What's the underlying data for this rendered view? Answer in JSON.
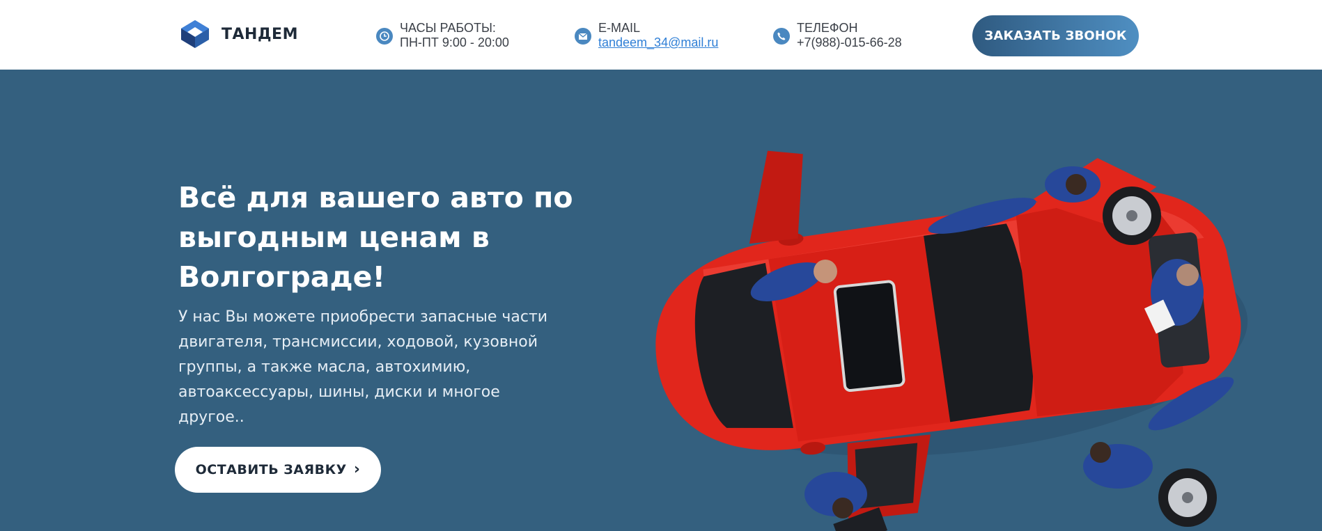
{
  "header": {
    "logo_text": "ТАНДЕМ",
    "hours": {
      "label": "ЧАСЫ РАБОТЫ:",
      "value": "ПН-ПТ 9:00 - 20:00",
      "icon": "clock-icon"
    },
    "email": {
      "label": "E-MAIL",
      "value": "tandeem_34@mail.ru",
      "icon": "envelope-icon"
    },
    "phone": {
      "label": "ТЕЛЕФОН",
      "value": "+7(988)-015-66-28",
      "icon": "phone-icon"
    },
    "cta_label": "ЗАКАЗАТЬ ЗВОНОК"
  },
  "hero": {
    "title": "Всё для вашего авто по выгодным ценам в Волгограде!",
    "description": "У нас Вы можете приобрести запасные части двигателя, трансмиссии, ходовой, кузовной группы, а также масла, автохимию, автоаксессуары, шины, диски и многое другое..",
    "button_label": "ОСТАВИТЬ ЗАЯВКУ",
    "image": "red-car-with-mechanics"
  },
  "colors": {
    "hero_bg": "#34607f",
    "accent": "#4a88c0",
    "link": "#2f7fd6",
    "car_red": "#e1261c"
  }
}
